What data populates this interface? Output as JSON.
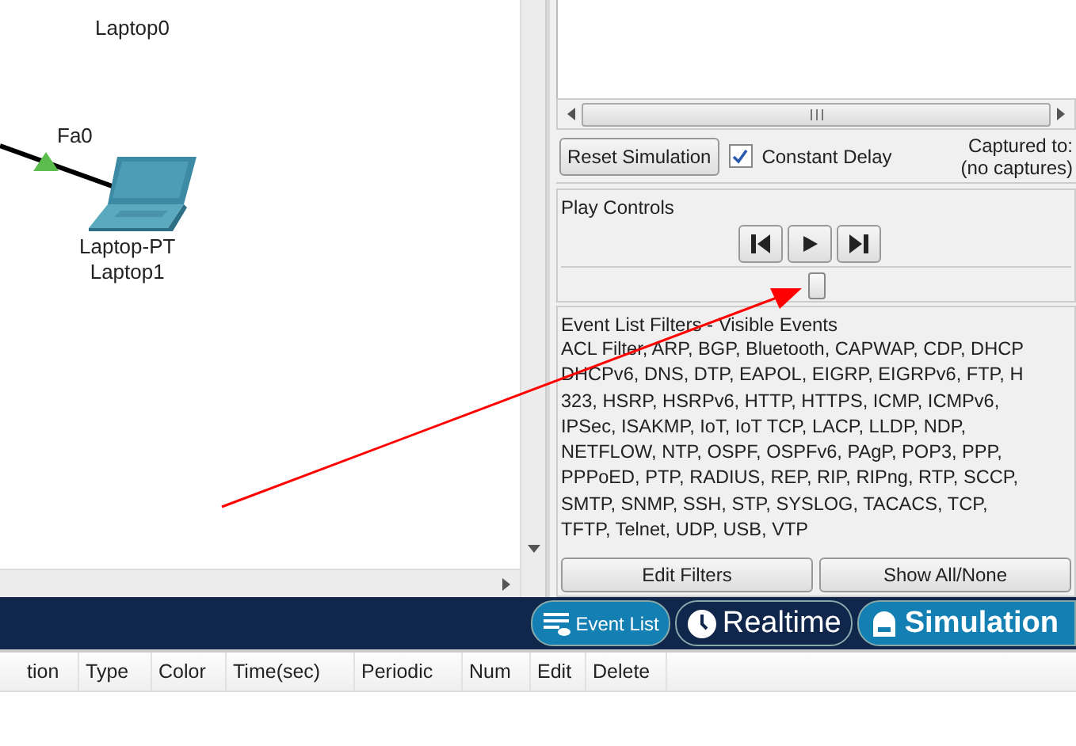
{
  "canvas": {
    "nodes": [
      {
        "kind": "label-only",
        "name": "Laptop0"
      },
      {
        "kind": "laptop",
        "model": "Laptop-PT",
        "name": "Laptop1",
        "port": "Fa0"
      }
    ]
  },
  "simulation_panel": {
    "reset_button": "Reset Simulation",
    "constant_delay": {
      "label": "Constant Delay",
      "checked": true
    },
    "captured_label": "Captured to:",
    "captured_value": "(no captures)",
    "play_controls": {
      "title": "Play Controls",
      "level": 0.5
    },
    "filters": {
      "title": "Event List Filters - Visible Events",
      "lines": [
        "ACL Filter, ARP, BGP, Bluetooth, CAPWAP, CDP, DHCP",
        "DHCPv6, DNS, DTP, EAPOL, EIGRP, EIGRPv6, FTP, H",
        "323, HSRP, HSRPv6, HTTP, HTTPS, ICMP, ICMPv6,",
        "IPSec, ISAKMP, IoT, IoT TCP, LACP, LLDP, NDP,",
        "NETFLOW, NTP, OSPF, OSPFv6, PAgP, POP3, PPP,",
        "PPPoED, PTP, RADIUS, REP, RIP, RIPng, RTP, SCCP,",
        "SMTP, SNMP, SSH, STP, SYSLOG, TACACS, TCP,",
        "TFTP, Telnet, UDP, USB, VTP"
      ],
      "buttons": [
        "Edit Filters",
        "Show All/None"
      ]
    }
  },
  "mode_bar": {
    "tabs": [
      {
        "kind": "event-list",
        "label": "Event List",
        "selected": true
      },
      {
        "kind": "realtime",
        "label": "Realtime",
        "selected": false
      },
      {
        "kind": "simulation",
        "label": "Simulation",
        "selected": true
      }
    ]
  },
  "pdu_table": {
    "columns": [
      "tion",
      "Type",
      "Color",
      "Time(sec)",
      "Periodic",
      "Num",
      "Edit",
      "Delete"
    ]
  }
}
